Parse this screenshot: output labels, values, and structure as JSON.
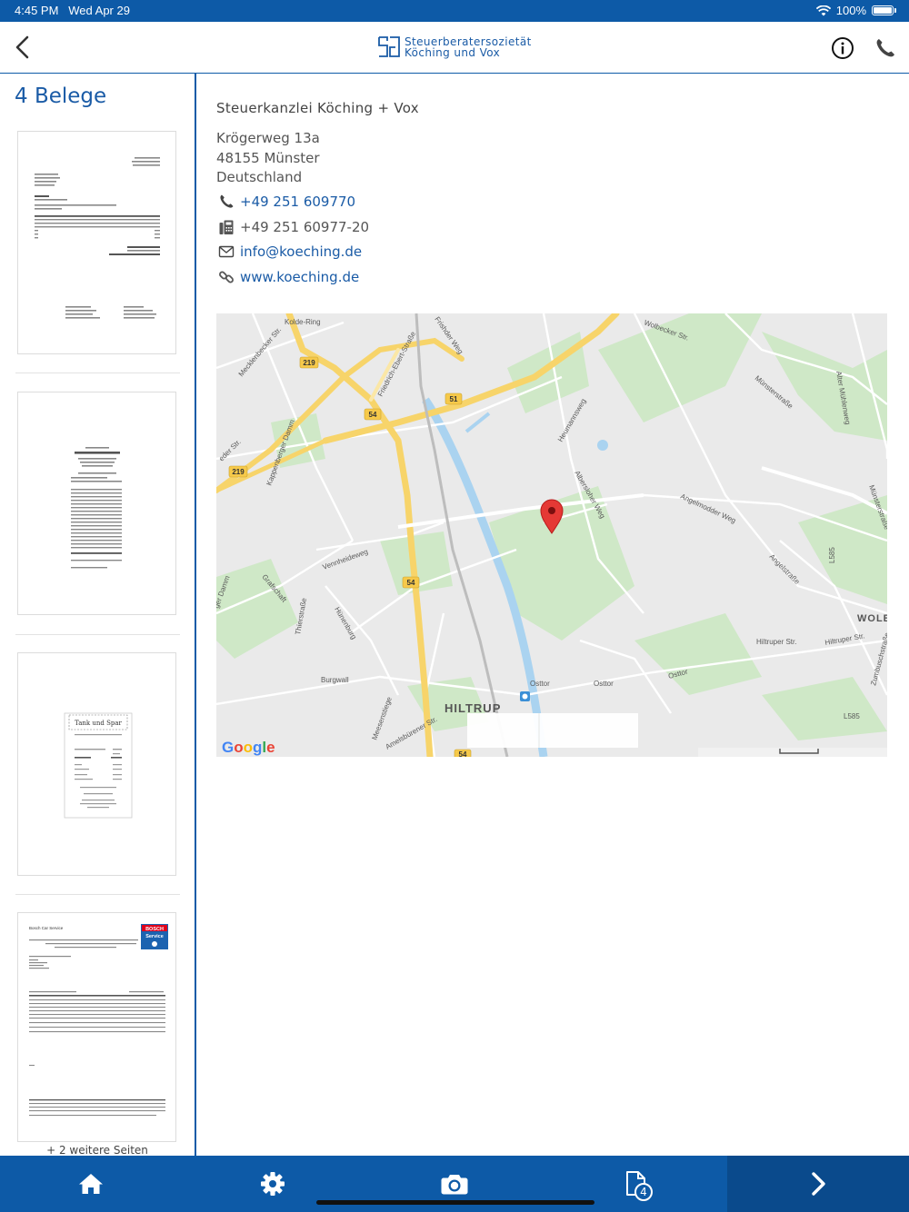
{
  "status_bar": {
    "time": "4:45 PM",
    "date": "Wed Apr 29",
    "battery": "100%"
  },
  "header": {
    "logo_line1": "Steuerberatersozietät",
    "logo_line2": "Köching und Vox"
  },
  "sidebar": {
    "title": "4 Belege",
    "more_pages": "+ 2 weitere Seiten"
  },
  "thumbnails": [
    {
      "name": "invoice-rechnung"
    },
    {
      "name": "restaurant-receipt"
    },
    {
      "name": "tank-und-spar-receipt",
      "heading": "Tank und Spar"
    },
    {
      "name": "bosch-car-service-invoice",
      "heading": "Bosch Car Service",
      "brand": "BOSCH Service"
    }
  ],
  "office": {
    "name": "Steuerkanzlei Köching + Vox",
    "street": "Krögerweg 13a",
    "city": "48155 Münster",
    "country": "Deutschland",
    "phone": "+49 251 609770",
    "fax": "+49 251 60977-20",
    "email": "info@koeching.de",
    "web": "www.koeching.de"
  },
  "map": {
    "google": "Google",
    "labels": {
      "kolde_ring": "Kolde-Ring",
      "mecklenbecker": "Mecklenbecker Str.",
      "friedrich_ebert": "Friedrich-Ebert-Straße",
      "wolbecker": "Wolbecker Str.",
      "muensterstrasse": "Münsterstraße",
      "alter_muehlenweg": "Alter Mühlenweg",
      "heumannsweg": "Heumannsweg",
      "albersloher": "Albersloher Weg",
      "angelmodder": "Angelmodder Weg",
      "kappenberger": "Kappenberger Damm",
      "vennheideweg": "Vennheideweg",
      "gras": "Grafschaft",
      "thierstrasse": "Thierstraße",
      "huenenburg": "Hünenburg",
      "burgwall": "Burgwall",
      "osttor": "Osttor",
      "hiltrup": "HILTRUP",
      "hiltruper": "Hiltruper Str.",
      "wolb": "WOLB",
      "meesenstiege": "Meesenstiege",
      "amelsbuerener": "Amelsbürener Str.",
      "angelstrasse": "Angelstraße",
      "zumbusch": "Zumbuschstraße",
      "l585": "L585",
      "muensterstrasse2": "Münsterstraße",
      "r219": "219",
      "r54": "54",
      "r51": "51",
      "frisher": "Frishder Weg",
      "gerdamm": "ger Damm",
      "ederstr": "eder Str."
    }
  },
  "tabbar": {
    "documents_count": "4"
  },
  "colors": {
    "brand_blue": "#0d5aa7",
    "link_blue": "#1a5ba6",
    "pin_red": "#d32f2f"
  }
}
